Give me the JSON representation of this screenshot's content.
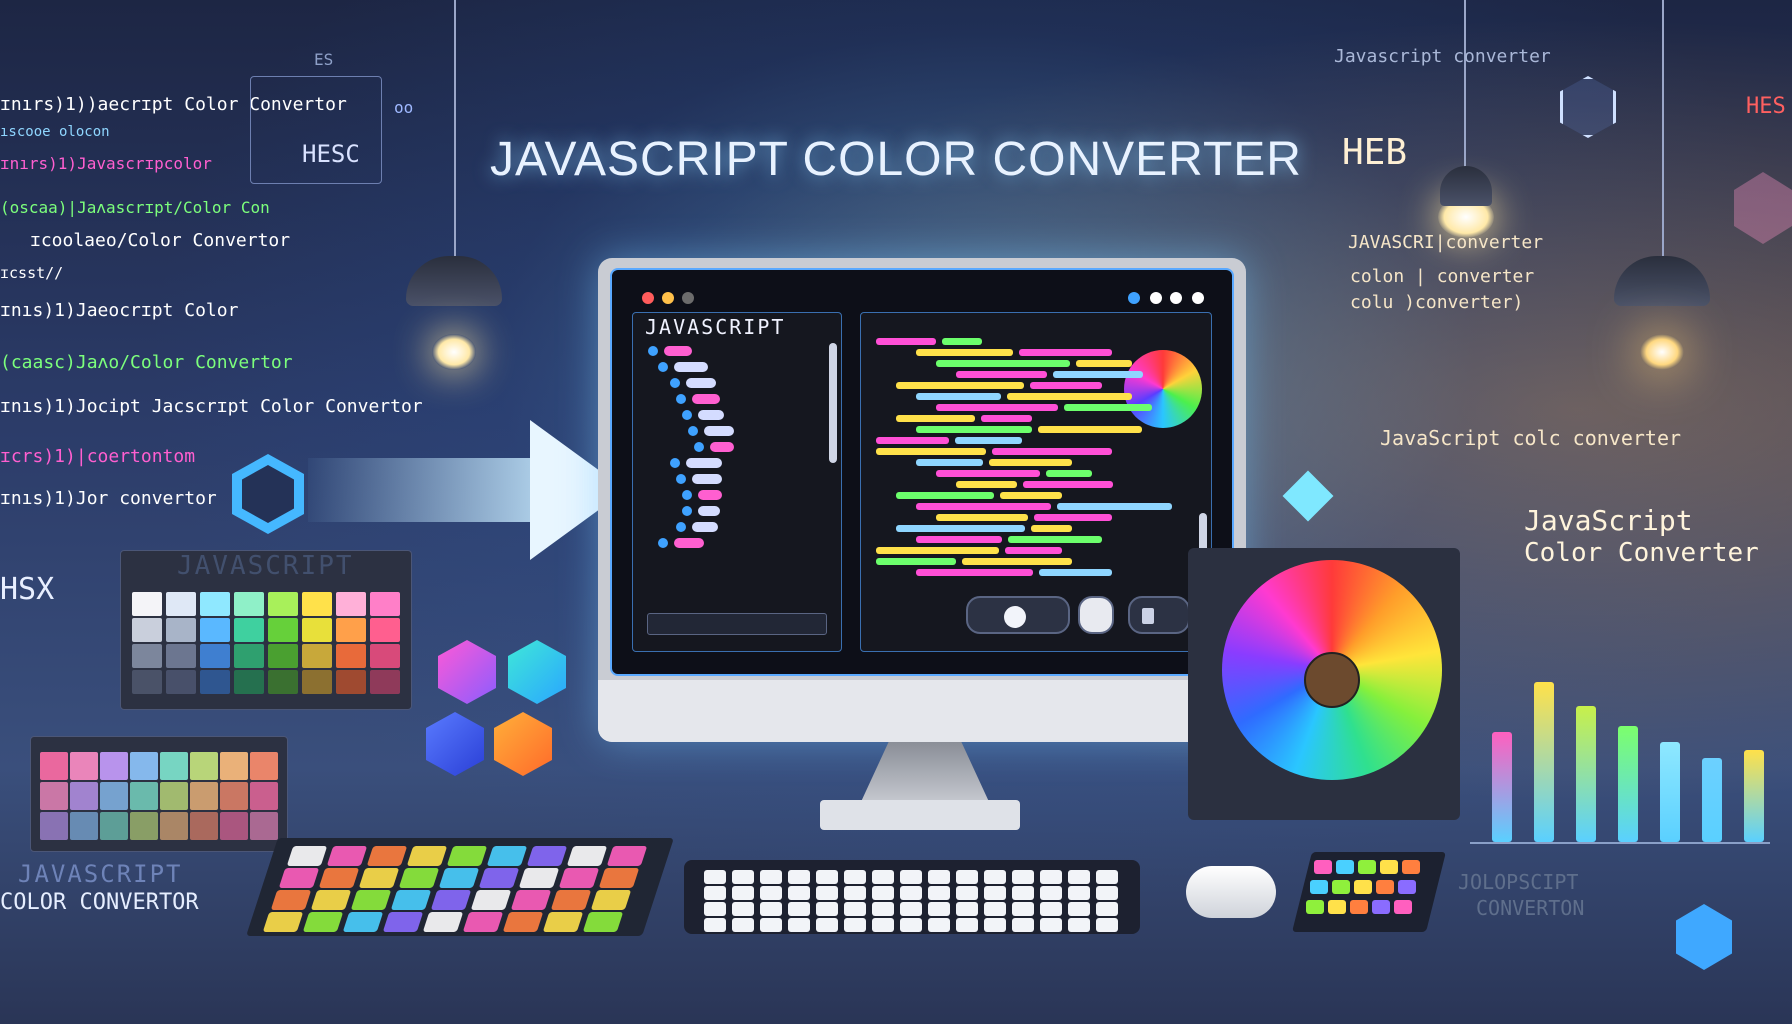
{
  "title": "JAVASCRIPT COLOR CONVERTER",
  "left_code_lines": [
    {
      "text": "ɪnırs)1))aecrɪpt Color Convertor",
      "color": "#ffffff"
    },
    {
      "text": "ıscooe olocon",
      "color": "#8fd6ff"
    },
    {
      "text": "ɪnırs)1)Javascrɪpcolor",
      "color": "#ff5fd0"
    },
    {
      "text": "(oscaa)|Jaʌascrɪpt/Color Con",
      "color": "#7cff7c"
    },
    {
      "text": "ɪcoolaeo/Color Convertor",
      "color": "#ff5fd0"
    },
    {
      "text": "ɪcsst//",
      "color": "#ffffff"
    },
    {
      "text": "ɪnıs)1)Jaeocrɪpt Color",
      "color": "#ffffff"
    },
    {
      "text": "(caasc)Jaʌo/Color Convertor",
      "color": "#7cff7c"
    },
    {
      "text": "ɪnıs)1)Jocipt Jacscrɪpt Color Convertor",
      "color": "#ffffff"
    },
    {
      "text": "ɪcrs)1)|coertontom",
      "color": "#ff5fd0"
    },
    {
      "text": "ɪnıs)1)Jor convertor",
      "color": "#ffffff"
    }
  ],
  "labels": {
    "hesc": "HESC",
    "heb": "HEB",
    "hes": "HES",
    "hsx": "HSX",
    "es": "ES",
    "od": "oo",
    "left_palette_title": "JAVASCRIPT",
    "bottom_left_line1": "JAVASCRIPT",
    "bottom_left_line2": "COLOR CONVERTOR",
    "bottom_right_line1": "JOLOPSCIPT",
    "bottom_right_line2": "CONVERTON",
    "top_right_title": "Javascript converter",
    "right_js_title": "JavaScript",
    "right_js_subtitle": "Color Converter"
  },
  "right_code_lines": [
    {
      "text": "JAVASCRI|converter"
    },
    {
      "text": "colon |  converter"
    },
    {
      "text": "colu )converter)"
    },
    {
      "text": "JavaScript colc converter"
    }
  ],
  "editor": {
    "left_pane_title": "JAVASCRIPT"
  },
  "colors": {
    "accent_blue": "#3fa2ff",
    "glow_orange": "#ffb04a",
    "code_pink": "#ff4fd6",
    "code_yellow": "#ffe14a",
    "code_green": "#6cff6c"
  },
  "bars": [
    {
      "height": 0.55,
      "color": "#ff5fbf"
    },
    {
      "height": 0.8,
      "color": "#ffe14a"
    },
    {
      "height": 0.68,
      "color": "#c8f04a"
    },
    {
      "height": 0.58,
      "color": "#7cff6c"
    },
    {
      "height": 0.5,
      "color": "#8fe8ff"
    },
    {
      "height": 0.42,
      "color": "#6cd0ff"
    },
    {
      "height": 0.46,
      "color": "#ffe14a"
    }
  ]
}
